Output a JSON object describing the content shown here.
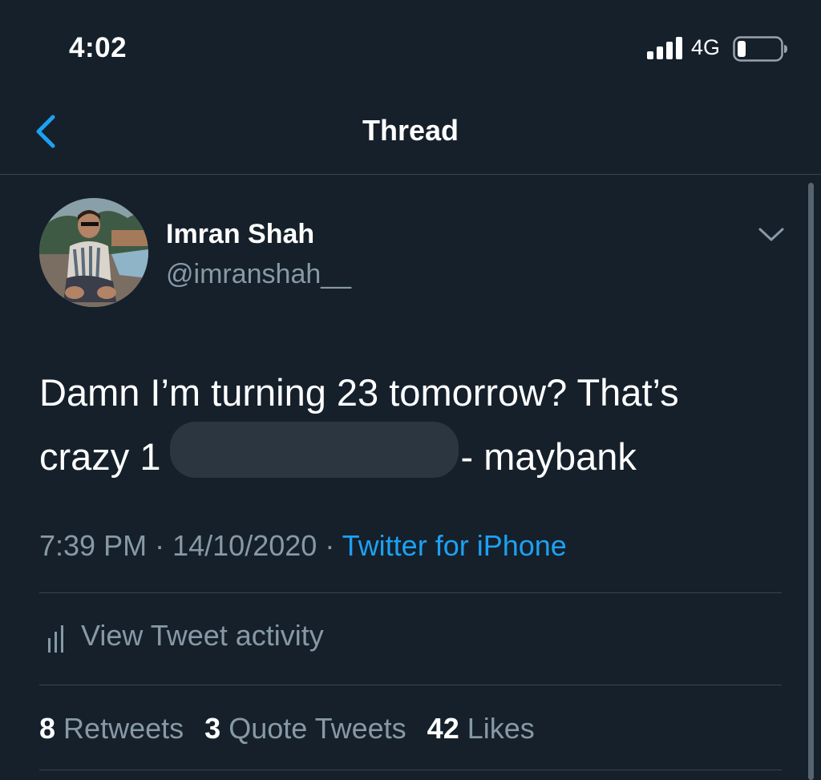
{
  "status_bar": {
    "time": "4:02",
    "network": "4G",
    "signal_icon": "cellular-signal-icon",
    "battery_icon": "battery-icon"
  },
  "nav": {
    "back_icon": "chevron-left-icon",
    "title": "Thread"
  },
  "tweet": {
    "author_name": "Imran Shah",
    "author_handle": "@imranshah__",
    "more_icon": "chevron-down-icon",
    "text_line1": "Damn I’m turning 23 tomorrow? That’s",
    "text_line2_start": "crazy 1",
    "text_line2_end": "- maybank",
    "time": "7:39 PM",
    "date": "14/10/2020",
    "separator": "·",
    "source": "Twitter for iPhone"
  },
  "activity": {
    "icon": "bar-chart-icon",
    "label": "View Tweet activity"
  },
  "stats": {
    "retweets_count": "8",
    "retweets_label": "Retweets",
    "quotes_count": "3",
    "quotes_label": "Quote Tweets",
    "likes_count": "42",
    "likes_label": "Likes"
  },
  "colors": {
    "background": "#15202b",
    "text_primary": "#ffffff",
    "text_secondary": "#8899a6",
    "accent": "#1da1f2",
    "divider": "#38444d"
  }
}
